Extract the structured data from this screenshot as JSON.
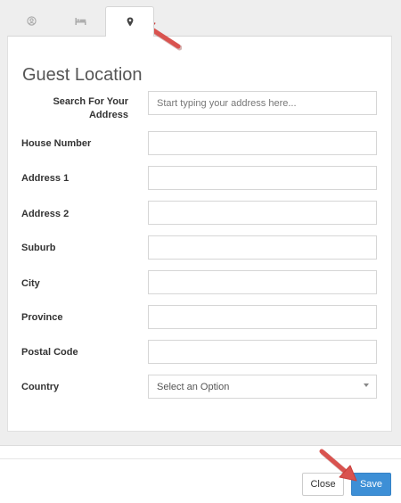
{
  "tabs": [
    {
      "icon": "user-circle-icon",
      "active": false
    },
    {
      "icon": "bed-icon",
      "active": false
    },
    {
      "icon": "map-pin-icon",
      "active": true
    }
  ],
  "form": {
    "title": "Guest Location",
    "search": {
      "label": "Search For Your Address",
      "placeholder": "Start typing your address here..."
    },
    "fields": [
      {
        "label": "House Number",
        "value": ""
      },
      {
        "label": "Address 1",
        "value": ""
      },
      {
        "label": "Address 2",
        "value": ""
      },
      {
        "label": "Suburb",
        "value": ""
      },
      {
        "label": "City",
        "value": ""
      },
      {
        "label": "Province",
        "value": ""
      },
      {
        "label": "Postal Code",
        "value": ""
      }
    ],
    "country": {
      "label": "Country",
      "selected": "Select an Option"
    }
  },
  "footer": {
    "close_label": "Close",
    "save_label": "Save"
  },
  "colors": {
    "primary": "#3d8fd6",
    "annotation_arrow": "#d9534f"
  }
}
